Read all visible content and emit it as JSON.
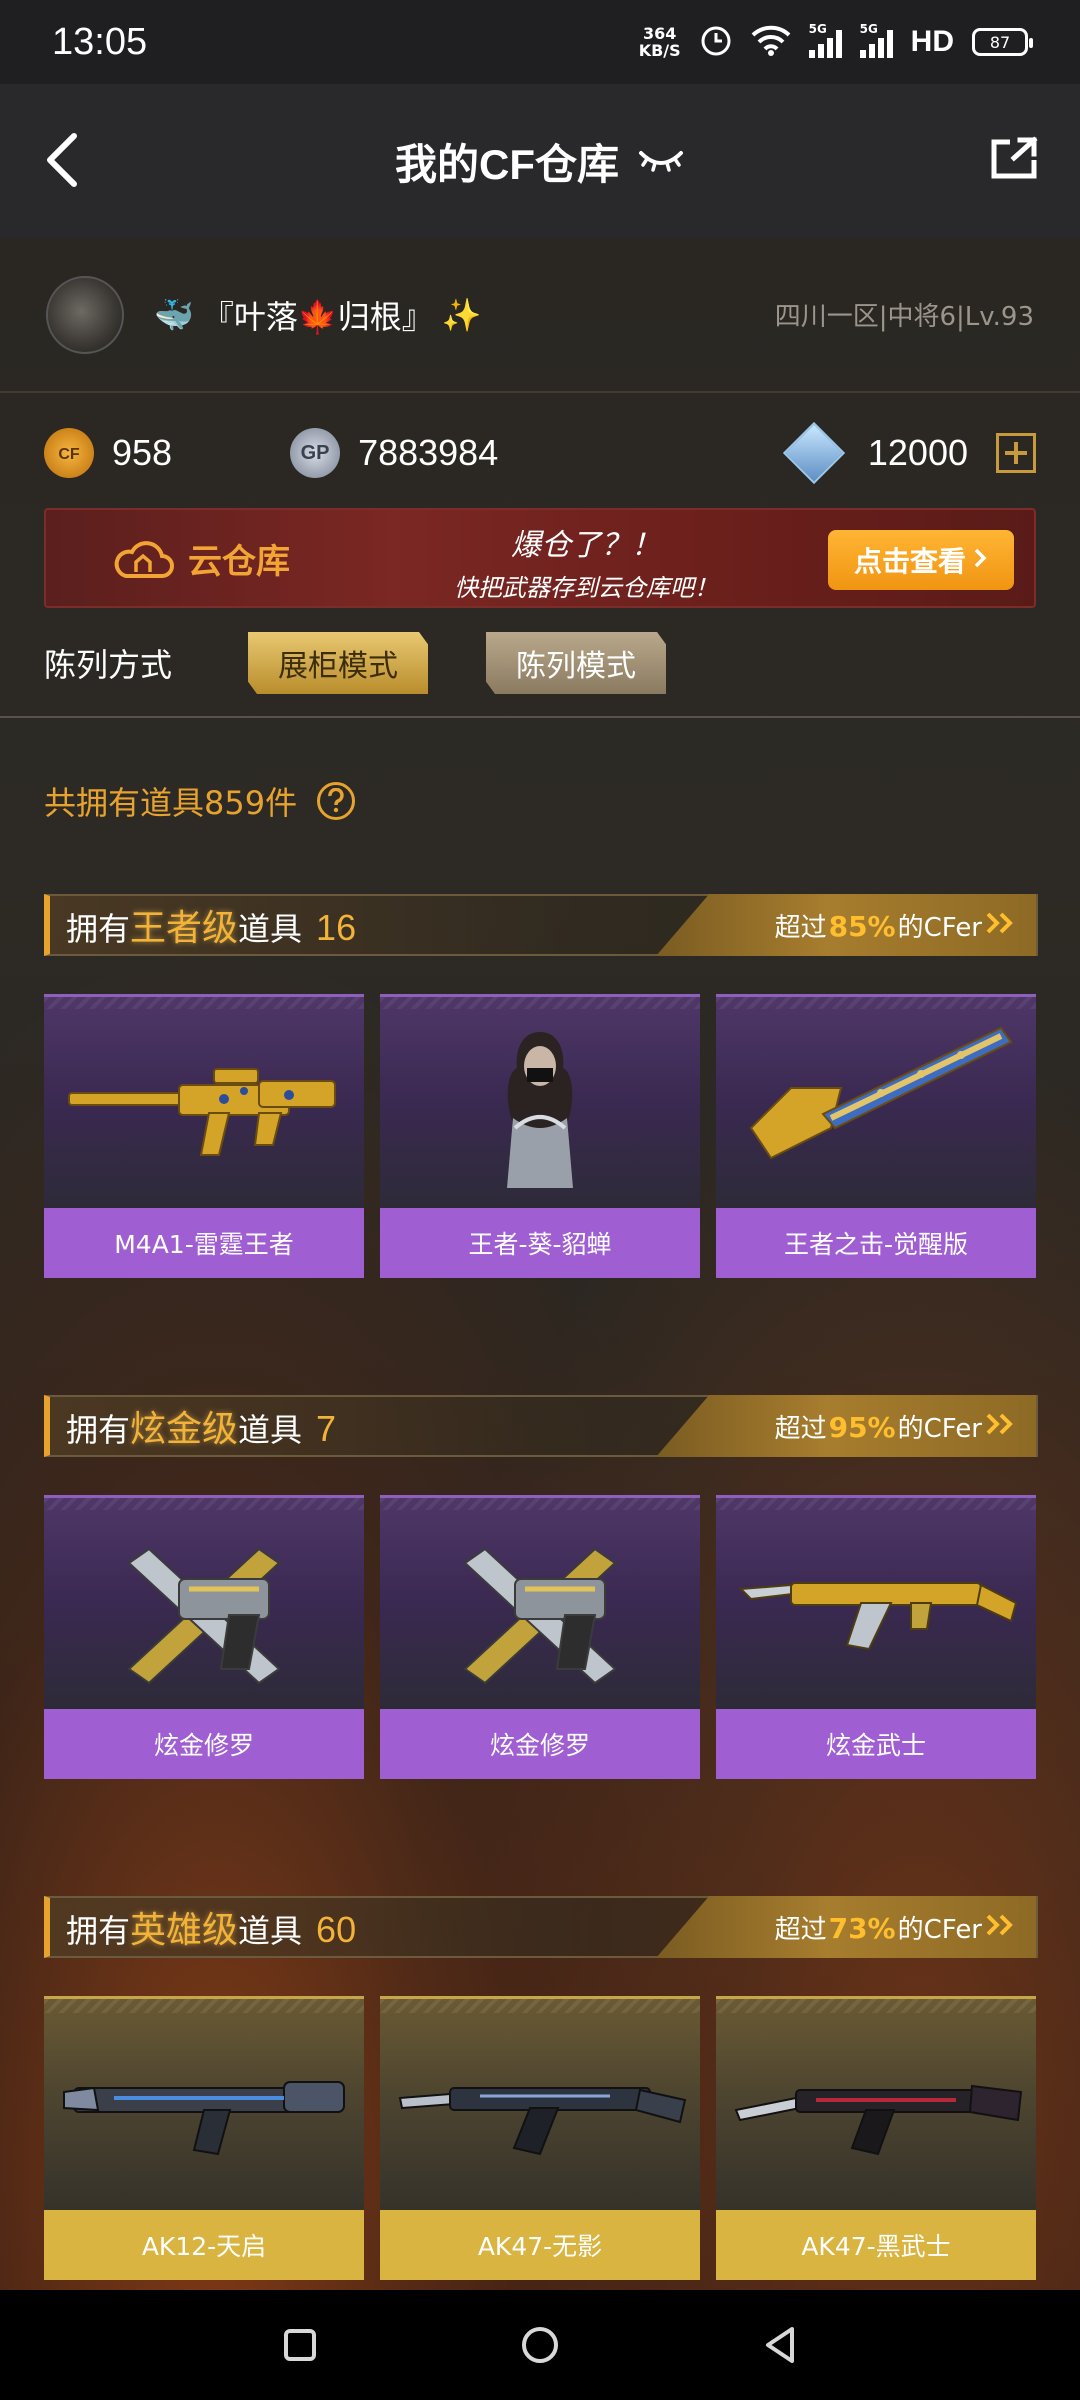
{
  "status": {
    "time": "13:05",
    "net_speed_value": "364",
    "net_speed_unit": "KB/S",
    "net_type_1": "5G",
    "net_type_2": "5G",
    "hd": "HD",
    "battery": "87"
  },
  "header": {
    "title": "我的CF仓库"
  },
  "profile": {
    "nickname": "『叶落🍁归根』",
    "nickname_prefix": "🐳",
    "nickname_suffix": "✨",
    "server_info": "四川一区|中将6|Lv.93"
  },
  "currency": {
    "cf_points": "958",
    "gp_label": "GP",
    "gp_points": "7883984",
    "diamonds": "12000"
  },
  "banner": {
    "title": "云仓库",
    "line1": "爆仓了？！",
    "line2": "快把武器存到云仓库吧！",
    "button": "点击查看"
  },
  "display_mode": {
    "label": "陈列方式",
    "options": [
      "展柜模式",
      "陈列模式"
    ],
    "selected": "展柜模式"
  },
  "total": {
    "text": "共拥有道具859件"
  },
  "sections": [
    {
      "prefix": "拥有",
      "tier": "王者级",
      "suffix": "道具",
      "count": "16",
      "rank_prefix": "超过",
      "rank_pct": "85%",
      "rank_suffix": "的CFer",
      "items": [
        "M4A1-雷霆王者",
        "王者-葵-貂蝉",
        "王者之击-觉醒版"
      ]
    },
    {
      "prefix": "拥有",
      "tier": "炫金级",
      "suffix": "道具",
      "count": "7",
      "rank_prefix": "超过",
      "rank_pct": "95%",
      "rank_suffix": "的CFer",
      "items": [
        "炫金修罗",
        "炫金修罗",
        "炫金武士"
      ]
    },
    {
      "prefix": "拥有",
      "tier": "英雄级",
      "suffix": "道具",
      "count": "60",
      "rank_prefix": "超过",
      "rank_pct": "73%",
      "rank_suffix": "的CFer",
      "items": [
        "AK12-天启",
        "AK47-无影",
        "AK47-黑武士"
      ]
    }
  ],
  "colors": {
    "accent_gold": "#e8a32f",
    "purple_tier": "#a05ed3",
    "gold_tier": "#d9b440",
    "banner_red": "#6d201c",
    "banner_button": "#f09512"
  },
  "icons": {
    "back": "chevron-left-icon",
    "eye": "eye-closed-icon",
    "share": "share-icon",
    "help": "question-icon",
    "nav_recent": "square-icon",
    "nav_home": "circle-icon",
    "nav_back": "triangle-back-icon"
  }
}
